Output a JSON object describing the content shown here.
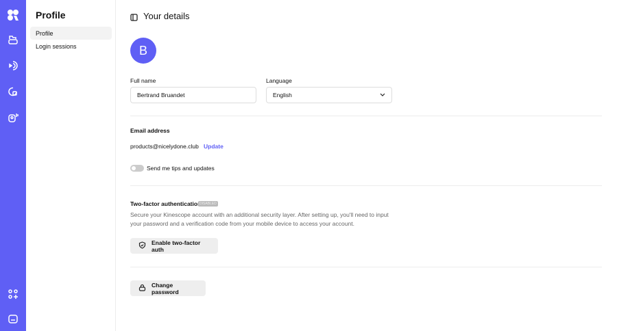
{
  "sidebar": {
    "title": "Profile",
    "items": [
      {
        "label": "Profile"
      },
      {
        "label": "Login sessions"
      }
    ]
  },
  "header": {
    "title": "Your details"
  },
  "avatar": {
    "initial": "B"
  },
  "form": {
    "full_name_label": "Full name",
    "full_name_value": "Bertrand Bruandet",
    "language_label": "Language",
    "language_value": "English"
  },
  "email": {
    "heading": "Email address",
    "value": "products@nicelydone.club",
    "update_label": "Update",
    "tips_label": "Send me tips and updates",
    "tips_enabled": false
  },
  "two_factor": {
    "heading": "Two-factor authentication",
    "badge": "DISABLED",
    "description": "Secure your Kinescope account with an additional security layer. After setting up, you'll need to input your password and a verification code from your mobile device to access your account.",
    "button_label": "Enable two-factor auth"
  },
  "password": {
    "button_label": "Change password"
  },
  "colors": {
    "accent": "#5f5ff5"
  }
}
